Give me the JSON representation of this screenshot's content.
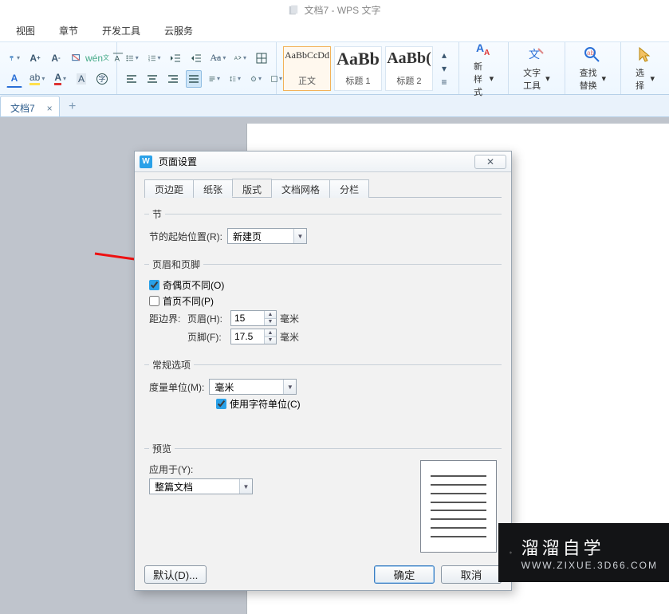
{
  "window": {
    "title": "文档7 - WPS 文字"
  },
  "menu": {
    "items": [
      "视图",
      "章节",
      "开发工具",
      "云服务"
    ]
  },
  "ribbon": {
    "font_caret": "▾",
    "styles": [
      {
        "preview": "AaBbCcDd",
        "label": "正文",
        "size": "12px",
        "selected": true
      },
      {
        "preview": "AaBb",
        "label": "标题 1",
        "size": "22px",
        "weight": "bold"
      },
      {
        "preview": "AaBb(",
        "label": "标题 2",
        "size": "20px",
        "weight": "bold"
      }
    ],
    "new_style": "新样式",
    "text_tools": "文字工具",
    "find_replace": "查找替换",
    "select": "选择"
  },
  "doc_tabs": {
    "active": "文档7",
    "close": "×",
    "add": "+"
  },
  "dialog": {
    "title": "页面设置",
    "close_glyph": "✕",
    "tabs": [
      "页边距",
      "纸张",
      "版式",
      "文档网格",
      "分栏"
    ],
    "active_tab": 2,
    "section": {
      "legend": "节",
      "start_label": "节的起始位置(R):",
      "start_value": "新建页"
    },
    "header_footer": {
      "legend": "页眉和页脚",
      "odd_even": {
        "label": "奇偶页不同(O)",
        "checked": true
      },
      "first_page": {
        "label": "首页不同(P)",
        "checked": false
      },
      "distance_label": "距边界:",
      "header_label": "页眉(H):",
      "header_value": "15",
      "footer_label": "页脚(F):",
      "footer_value": "17.5",
      "unit": "毫米"
    },
    "general": {
      "legend": "常规选项",
      "measure_label": "度量单位(M):",
      "measure_value": "毫米",
      "char_unit": {
        "label": "使用字符单位(C)",
        "checked": true
      }
    },
    "preview": {
      "legend": "预览",
      "apply_label": "应用于(Y):",
      "apply_value": "整篇文档"
    },
    "buttons": {
      "default": "默认(D)...",
      "ok": "确定",
      "cancel": "取消"
    }
  },
  "brand": {
    "name": "溜溜自学",
    "url": "WWW.ZIXUE.3D66.COM"
  }
}
